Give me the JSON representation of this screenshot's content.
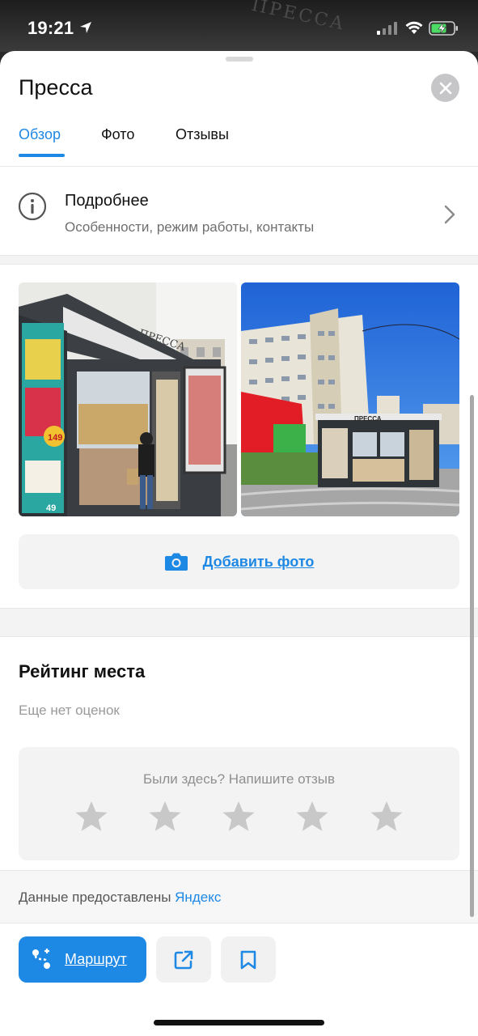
{
  "status_bar": {
    "time": "19:21"
  },
  "background_sign": "ПРЕССА",
  "place": {
    "title": "Пресса"
  },
  "tabs": [
    {
      "label": "Обзор",
      "active": true
    },
    {
      "label": "Фото",
      "active": false
    },
    {
      "label": "Отзывы",
      "active": false
    }
  ],
  "details": {
    "title": "Подробнее",
    "subtitle": "Особенности, режим работы, контакты"
  },
  "photos": [
    {
      "sign": "ПРЕССА",
      "poster_price": "149",
      "poster_price2": "49"
    },
    {
      "sign": "ПРЕССА"
    }
  ],
  "add_photo": {
    "label": "Добавить фото"
  },
  "rating": {
    "title": "Рейтинг места",
    "subtitle": "Еще нет оценок",
    "prompt": "Были здесь? Напишите отзыв",
    "stars_total": 5,
    "stars_filled": 0
  },
  "source": {
    "prefix": "Данные предоставлены ",
    "link": "Яндекс"
  },
  "actions": {
    "route_label": "Маршрут"
  },
  "colors": {
    "accent": "#1e88e5",
    "star": "#c8c8c8",
    "close_bg": "#c6c6c8"
  },
  "icons": [
    "location-arrow-icon",
    "signal-icon",
    "wifi-icon",
    "battery-charging-icon",
    "close-icon",
    "info-icon",
    "chevron-right-icon",
    "camera-icon",
    "star-icon",
    "route-icon",
    "share-icon",
    "bookmark-icon"
  ]
}
